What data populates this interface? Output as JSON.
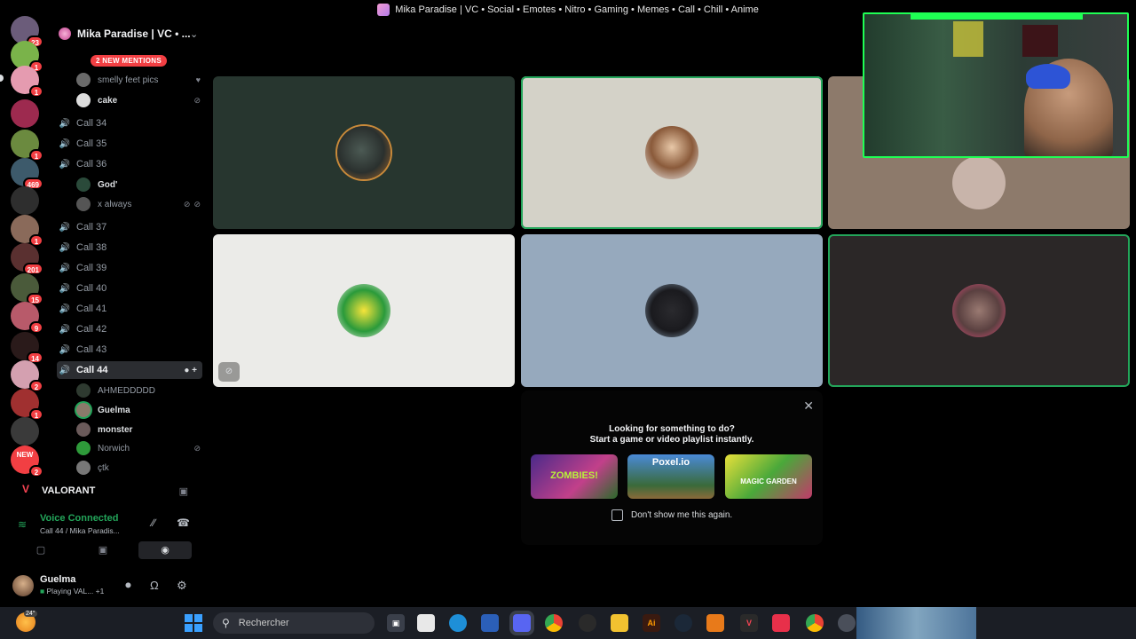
{
  "window": {
    "title": "Mika Paradise | VC • Social • Emotes • Nitro • Gaming • Memes • Call • Chill • Anime"
  },
  "rail": {
    "badges": [
      "23",
      "1",
      "1",
      "1",
      "469",
      "1",
      "1",
      "201",
      "15",
      "9",
      "14",
      "2",
      "1",
      "2"
    ],
    "new_label": "NEW"
  },
  "guild": {
    "name": "Mika Paradise | VC • ...",
    "mentions_label": "2 NEW MENTIONS"
  },
  "channels": {
    "top_users": [
      {
        "name": "smelly feet pics"
      },
      {
        "name": "cake"
      }
    ],
    "call34": "Call 34",
    "call35": "Call 35",
    "call36": "Call 36",
    "call36_users": [
      {
        "name": "God'"
      },
      {
        "name": "x always"
      }
    ],
    "call37": "Call 37",
    "call38": "Call 38",
    "call39": "Call 39",
    "call40": "Call 40",
    "call41": "Call 41",
    "call42": "Call 42",
    "call43": "Call 43",
    "call44": "Call 44",
    "call44_users": [
      {
        "name": "AHMEDDDDD"
      },
      {
        "name": "Guelma"
      },
      {
        "name": "monster"
      },
      {
        "name": "Norwich"
      },
      {
        "name": "çtk"
      }
    ]
  },
  "activity": {
    "game": "VALORANT"
  },
  "voice": {
    "status": "Voice Connected",
    "channel": "Call 44 / Mika Paradis..."
  },
  "user": {
    "name": "Guelma",
    "status": "Playing VAL...",
    "extra": "+1"
  },
  "popup": {
    "line1": "Looking for something to do?",
    "line2": "Start a game or video playlist instantly.",
    "games": [
      {
        "name": "ZOMBIES!"
      },
      {
        "name": "Poxel.io"
      },
      {
        "name": "MAGIC GARDEN"
      }
    ],
    "checkbox_label": "Don't show me this again."
  },
  "taskbar": {
    "search_placeholder": "Rechercher",
    "weather_temp": "24°"
  },
  "colors": {
    "speaking": "#23a55a",
    "mention": "#f23f43",
    "webcam_border": "#1fff54"
  }
}
